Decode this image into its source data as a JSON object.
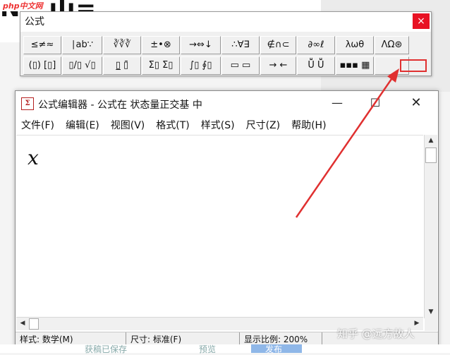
{
  "background": {
    "logo_text": "php中文网",
    "bg_title_fragment": "NX ılı=",
    "footer_items": [
      "获稿已保存",
      "预览",
      "发布"
    ]
  },
  "palette": {
    "title": "公式",
    "close_icon": "×",
    "row1": [
      "≤≠≈",
      "∣ab∵",
      "∛∛∛",
      "±•⊗",
      "→⇔↓",
      "∴∀∃",
      "∉∩⊂",
      "∂∞ℓ",
      "λωθ",
      "ΛΩ⊛"
    ],
    "row2": [
      "(▯) [▯]",
      "▯/▯ √▯",
      "▯̲ ▯̄",
      "Σ▯ Σ▯",
      "∫▯ ∮▯",
      "▭ ▭",
      "→ ←",
      "Ṻ Ṻ",
      "▪▪▪ ▦",
      ""
    ]
  },
  "editor": {
    "title": "公式编辑器 - 公式在 状态量正交基 中",
    "icon": "Σ",
    "menu": [
      "文件(F)",
      "编辑(E)",
      "视图(V)",
      "格式(T)",
      "样式(S)",
      "尺寸(Z)",
      "帮助(H)"
    ],
    "formula": "x",
    "status": [
      "样式: 数学(M)",
      "尺寸: 标准(F)",
      "显示比例: 200%"
    ]
  },
  "watermark": "知乎 @远方故人",
  "colors": {
    "annotation_red": "#e03030",
    "close_red": "#e81123"
  }
}
